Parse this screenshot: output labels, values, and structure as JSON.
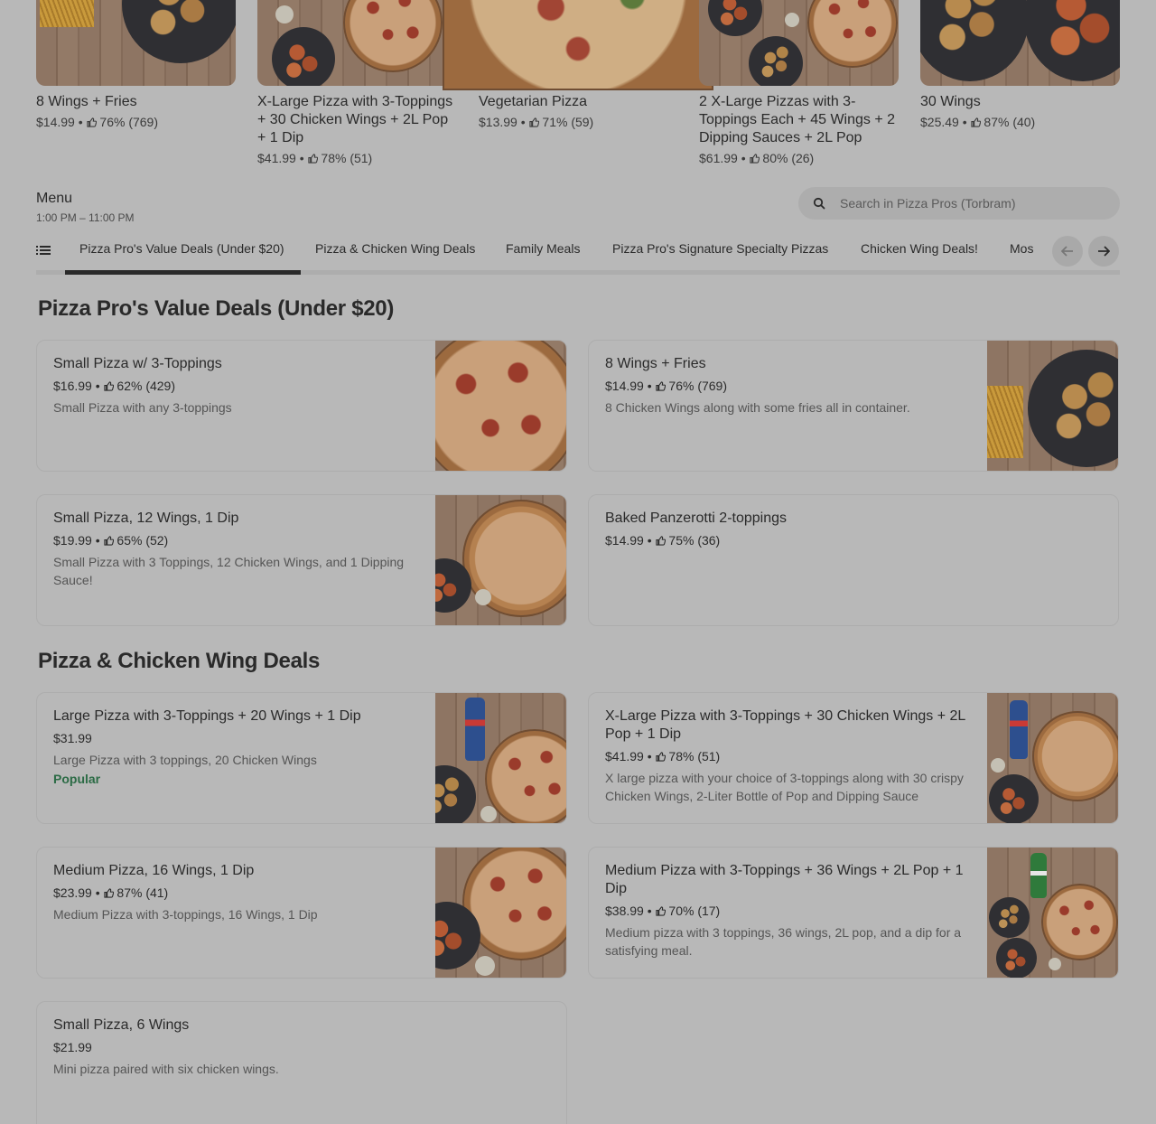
{
  "carousel": [
    {
      "title": "8 Wings + Fries",
      "price": "$14.99",
      "rating": "76% (769)"
    },
    {
      "title": "X-Large Pizza with 3-Toppings + 30 Chicken Wings + 2L Pop + 1 Dip",
      "price": "$41.99",
      "rating": "78% (51)"
    },
    {
      "title": "Vegetarian Pizza",
      "price": "$13.99",
      "rating": "71% (59)"
    },
    {
      "title": "2 X-Large Pizzas with 3-Toppings Each + 45 Wings + 2 Dipping Sauces + 2L Pop",
      "price": "$61.99",
      "rating": "80% (26)"
    },
    {
      "title": "30 Wings",
      "price": "$25.49",
      "rating": "87% (40)"
    }
  ],
  "menu": {
    "title": "Menu",
    "hours": "1:00 PM – 11:00 PM"
  },
  "search": {
    "placeholder": "Search in Pizza Pros (Torbram)"
  },
  "tabs": [
    "Pizza Pro's Value Deals (Under $20)",
    "Pizza & Chicken Wing Deals",
    "Family Meals",
    "Pizza Pro's Signature Specialty Pizzas",
    "Chicken Wing Deals!",
    "Mos"
  ],
  "sections": [
    {
      "title": "Pizza Pro's Value Deals (Under $20)",
      "items": [
        {
          "name": "Small Pizza w/ 3-Toppings",
          "price": "$16.99",
          "rating": "62% (429)",
          "desc": "Small Pizza with any 3-toppings"
        },
        {
          "name": "8 Wings + Fries",
          "price": "$14.99",
          "rating": "76% (769)",
          "desc": "8 Chicken Wings along with some fries all in container."
        },
        {
          "name": "Small Pizza, 12 Wings, 1 Dip",
          "price": "$19.99",
          "rating": "65% (52)",
          "desc": "Small Pizza with 3 Toppings, 12 Chicken Wings, and 1 Dipping Sauce!"
        },
        {
          "name": "Baked Panzerotti 2-toppings",
          "price": "$14.99",
          "rating": "75% (36)",
          "desc": ""
        }
      ]
    },
    {
      "title": "Pizza & Chicken Wing Deals",
      "items": [
        {
          "name": "Large Pizza with 3-Toppings + 20 Wings + 1 Dip",
          "price": "$31.99",
          "rating": "",
          "desc": "Large Pizza with 3 toppings, 20 Chicken Wings",
          "badge": "Popular"
        },
        {
          "name": "X-Large Pizza with 3-Toppings + 30 Chicken Wings + 2L Pop + 1 Dip",
          "price": "$41.99",
          "rating": "78% (51)",
          "desc": "X large pizza with your choice of 3-toppings along with 30 crispy Chicken Wings, 2-Liter Bottle of Pop and Dipping Sauce"
        },
        {
          "name": "Medium Pizza, 16 Wings, 1 Dip",
          "price": "$23.99",
          "rating": "87% (41)",
          "desc": "Medium Pizza with 3-toppings, 16 Wings, 1 Dip"
        },
        {
          "name": "Medium Pizza with 3-Toppings + 36 Wings + 2L Pop + 1 Dip",
          "price": "$38.99",
          "rating": "70% (17)",
          "desc": "Medium pizza with 3 toppings, 36 wings, 2L pop, and a dip for a satisfying meal."
        },
        {
          "name": "Small Pizza, 6 Wings",
          "price": "$21.99",
          "rating": "",
          "desc": "Mini pizza paired with six chicken wings."
        }
      ]
    }
  ],
  "sep": " • ",
  "colors": {
    "overlay_bg": "#b8b8b8",
    "popular": "#2b6b45",
    "text": "#2a2a2a"
  }
}
